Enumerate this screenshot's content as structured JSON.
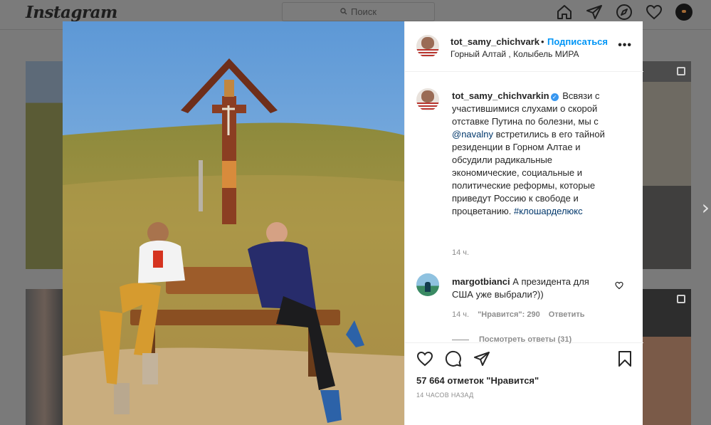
{
  "app": {
    "logo": "Instagram"
  },
  "search": {
    "placeholder": "Поиск"
  },
  "nav": {
    "icons": [
      "home-icon",
      "direct-icon",
      "explore-icon",
      "activity-heart-icon",
      "profile-avatar"
    ]
  },
  "post": {
    "username": "tot_samy_chichvark",
    "separator": "•",
    "follow_label": "Подписаться",
    "location": "Горный Алтай , Колыбель МИРА",
    "more_label": "•••"
  },
  "caption": {
    "username": "tot_samy_chichvarkin",
    "text_part1": "Всвязи с участившимися слухами о скорой отставке Путина по болезни, мы с ",
    "mention": "@navalny",
    "text_part2": " встретились в его тайной резиденции в Горном Алтае и обсудили радикальные экономические, социальные и политические реформы, которые приведут Россию к свободе и процветанию. ",
    "hashtag": "#клошарделюкс",
    "time": "14 ч."
  },
  "comment": {
    "username": "margotbianci",
    "text": "А президента для США уже выбрали?))",
    "time": "14 ч.",
    "likes": "\"Нравится\": 290",
    "reply_label": "Ответить",
    "view_replies": "Посмотреть ответы (31)"
  },
  "footer": {
    "likes": "57 664 отметок \"Нравится\"",
    "timestamp": "14 ЧАСОВ НАЗАД"
  },
  "colors": {
    "accent": "#0095f6",
    "link": "#00376b",
    "secondary": "#8e8e8e"
  }
}
